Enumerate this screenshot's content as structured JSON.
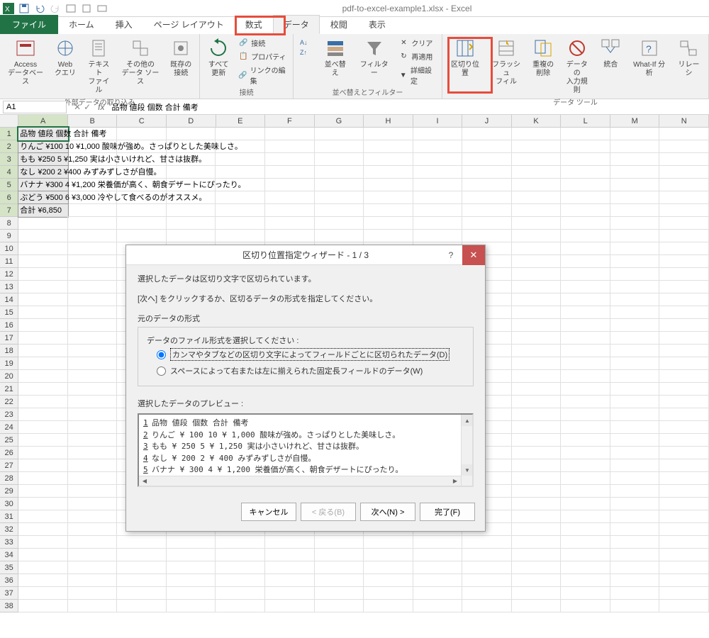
{
  "titlebar": {
    "title": "pdf-to-excel-example1.xlsx - Excel"
  },
  "tabs": {
    "file": "ファイル",
    "home": "ホーム",
    "insert": "挿入",
    "layout": "ページ レイアウト",
    "formulas": "数式",
    "data": "データ",
    "review": "校閲",
    "view": "表示"
  },
  "ribbon": {
    "get_external": {
      "access": "Access\nデータベース",
      "web": "Web\nクエリ",
      "text": "テキスト\nファイル",
      "other": "その他の\nデータ ソース",
      "existing": "既存の\n接続",
      "group": "外部データの取り込み"
    },
    "connections": {
      "refresh": "すべて\n更新",
      "conn": "接続",
      "prop": "プロパティ",
      "edit": "リンクの編集",
      "group": "接続"
    },
    "sortfilter": {
      "sort": "並べ替え",
      "filter": "フィルター",
      "clear": "クリア",
      "reapply": "再適用",
      "advanced": "詳細設定",
      "group": "並べ替えとフィルター"
    },
    "datatools": {
      "text_to_cols": "区切り位置",
      "flash": "フラッシュ\nフィル",
      "dup": "重複の\n削除",
      "validation": "データの\n入力規則",
      "consolidate": "統合",
      "whatif": "What-If 分析",
      "relations": "リレーシ",
      "group": "データ ツール"
    }
  },
  "namebox": "A1",
  "formula": "品物 値段 個数 合計 備考",
  "columns": [
    "A",
    "B",
    "C",
    "D",
    "E",
    "F",
    "G",
    "H",
    "I",
    "J",
    "K",
    "L",
    "M",
    "N"
  ],
  "sheet": {
    "r1": "品物 値段 個数 合計 備考",
    "r2": "りんご ¥100 10 ¥1,000 酸味が強め。さっぱりとした美味しさ。",
    "r3": "もも ¥250 5 ¥1,250 実は小さいけれど、甘さは抜群。",
    "r4": "なし ¥200 2 ¥400 みずみずしさが自慢。",
    "r5": "バナナ ¥300 4 ¥1,200 栄養価が高く、朝食デザートにぴったり。",
    "r6": "ぶどう ¥500 6 ¥3,000 冷やして食べるのがオススメ。",
    "r7": "合計  ¥6,850"
  },
  "dialog": {
    "title": "区切り位置指定ウィザード - 1 / 3",
    "msg1": "選択したデータは区切り文字で区切られています。",
    "msg2": "[次へ] をクリックするか、区切るデータの形式を指定してください。",
    "section": "元のデータの形式",
    "fieldset_label": "データのファイル形式を選択してください :",
    "radio1": "カンマやタブなどの区切り文字によってフィールドごとに区切られたデータ(D)",
    "radio2": "スペースによって右または左に揃えられた固定長フィールドのデータ(W)",
    "preview_label": "選択したデータのプレビュー :",
    "preview": [
      "品物 値段 個数 合計 備考",
      "りんご ¥ 100 10 ¥ 1,000 酸味が強め。さっぱりとした美味しさ。",
      "もも ¥ 250 5 ¥ 1,250 実は小さいけれど、甘さは抜群。",
      "なし ¥ 200 2 ¥ 400 みずみずしさが自慢。",
      "バナナ ¥ 300 4 ¥ 1,200 栄養価が高く、朝食デザートにぴったり。"
    ],
    "btn_cancel": "キャンセル",
    "btn_back": "< 戻る(B)",
    "btn_next": "次へ(N) >",
    "btn_finish": "完了(F)"
  }
}
